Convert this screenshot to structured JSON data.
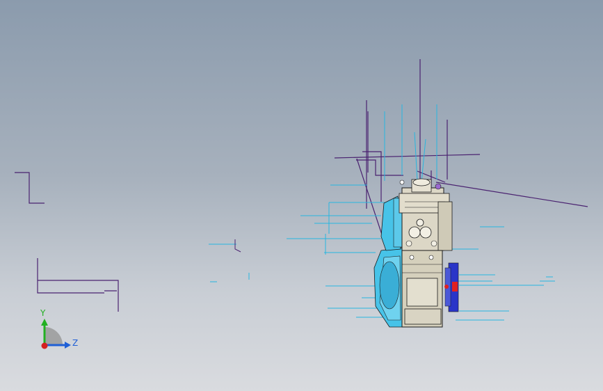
{
  "window": {
    "background_top": "#8b9bad",
    "background_bottom": "#d9dbdf"
  },
  "colors": {
    "wire_purple": "#4a2270",
    "wire_cyan": "#27b6e0",
    "model_cyan": "#47c3e8",
    "model_beige": "#d8d3c0",
    "model_outline": "#1a1a1a",
    "accent_blue": "#2a35c8",
    "accent_red": "#e02020"
  },
  "triad": {
    "x_axis_color": "#d42020",
    "y_axis_color": "#22b022",
    "z_axis_color": "#1f5fd6",
    "y_label": "Y",
    "z_label": "Z"
  },
  "model": {
    "icon": "engine-assembly-icon"
  }
}
